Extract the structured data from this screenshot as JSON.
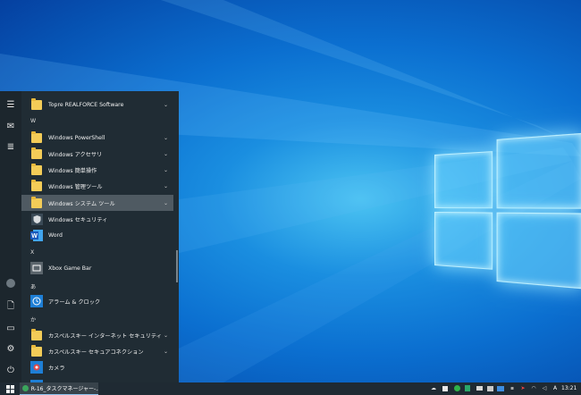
{
  "start_menu": {
    "items": [
      {
        "type": "app",
        "label": "Topre REALFORCE Software",
        "icon": "folder-icon",
        "expand": true
      },
      {
        "type": "header",
        "label": "W"
      },
      {
        "type": "app",
        "label": "Windows PowerShell",
        "icon": "folder-icon",
        "expand": true
      },
      {
        "type": "app",
        "label": "Windows アクセサリ",
        "icon": "folder-icon",
        "expand": true
      },
      {
        "type": "app",
        "label": "Windows 簡単操作",
        "icon": "folder-icon",
        "expand": true
      },
      {
        "type": "app",
        "label": "Windows 管理ツール",
        "icon": "folder-icon",
        "expand": true
      },
      {
        "type": "app",
        "label": "Windows システム ツール",
        "icon": "folder-icon",
        "expand": true,
        "selected": true
      },
      {
        "type": "app",
        "label": "Windows セキュリティ",
        "icon": "shield-icon",
        "expand": false
      },
      {
        "type": "app",
        "label": "Word",
        "icon": "word-icon",
        "expand": false
      },
      {
        "type": "header",
        "label": "X"
      },
      {
        "type": "app",
        "label": "Xbox Game Bar",
        "icon": "xbox-icon",
        "expand": false
      },
      {
        "type": "header",
        "label": "あ"
      },
      {
        "type": "app",
        "label": "アラーム & クロック",
        "icon": "clock-icon",
        "expand": false
      },
      {
        "type": "header",
        "label": "か"
      },
      {
        "type": "app",
        "label": "カスペルスキー インターネット セキュリティ",
        "icon": "folder-icon",
        "expand": true
      },
      {
        "type": "app",
        "label": "カスペルスキー セキュアコネクション",
        "icon": "folder-icon",
        "expand": true
      },
      {
        "type": "app",
        "label": "カメラ",
        "icon": "camera-icon",
        "expand": false
      }
    ]
  },
  "taskbar": {
    "window_label": "R-16_タスクマネージャー-...",
    "clock": "13:21",
    "ime": "A"
  }
}
